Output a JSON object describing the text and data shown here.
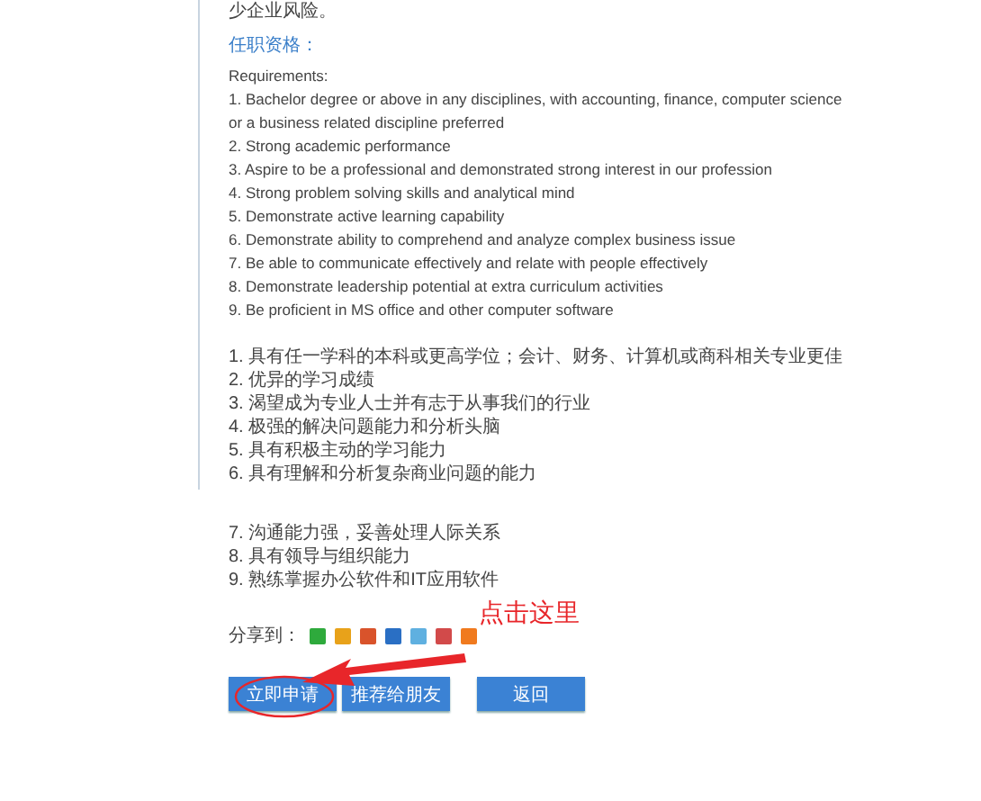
{
  "intro_tail": "少企业风险。",
  "qualification_heading": "任职资格：",
  "requirements_heading": "Requirements:",
  "requirements_en": [
    "1. Bachelor degree or above in any disciplines, with accounting, finance, computer science or a business related discipline preferred",
    "2. Strong academic performance",
    "3. Aspire to be a professional and demonstrated strong interest in our profession",
    "4. Strong problem solving skills and analytical mind",
    "5. Demonstrate active learning capability",
    "6. Demonstrate ability to comprehend and analyze complex business issue",
    "7. Be able to communicate effectively and relate with people effectively",
    "8. Demonstrate leadership potential at extra curriculum activities",
    "9. Be proficient in MS office and other computer software"
  ],
  "requirements_cn": [
    "1. 具有任一学科的本科或更高学位；会计、财务、计算机或商科相关专业更佳",
    "2. 优异的学习成绩",
    "3. 渴望成为专业人士并有志于从事我们的行业",
    "4. 极强的解决问题能力和分析头脑",
    "5. 具有积极主动的学习能力",
    "6. 具有理解和分析复杂商业问题的能力"
  ],
  "requirements_cn_continued": [
    "7. 沟通能力强，妥善处理人际关系",
    "8. 具有领导与组织能力",
    "9. 熟练掌握办公软件和IT应用软件"
  ],
  "share": {
    "label": "分享到：",
    "services": [
      {
        "color": "#2eaa3c"
      },
      {
        "color": "#e8a21a"
      },
      {
        "color": "#d9532b"
      },
      {
        "color": "#2a6fc4"
      },
      {
        "color": "#5fb0e0"
      },
      {
        "color": "#d24a4a"
      },
      {
        "color": "#f07a1e"
      }
    ]
  },
  "buttons": [
    {
      "label": "立即申请"
    },
    {
      "label": "推荐给朋友"
    },
    {
      "label": "返回"
    }
  ],
  "annotation": {
    "text": "点击这里"
  }
}
